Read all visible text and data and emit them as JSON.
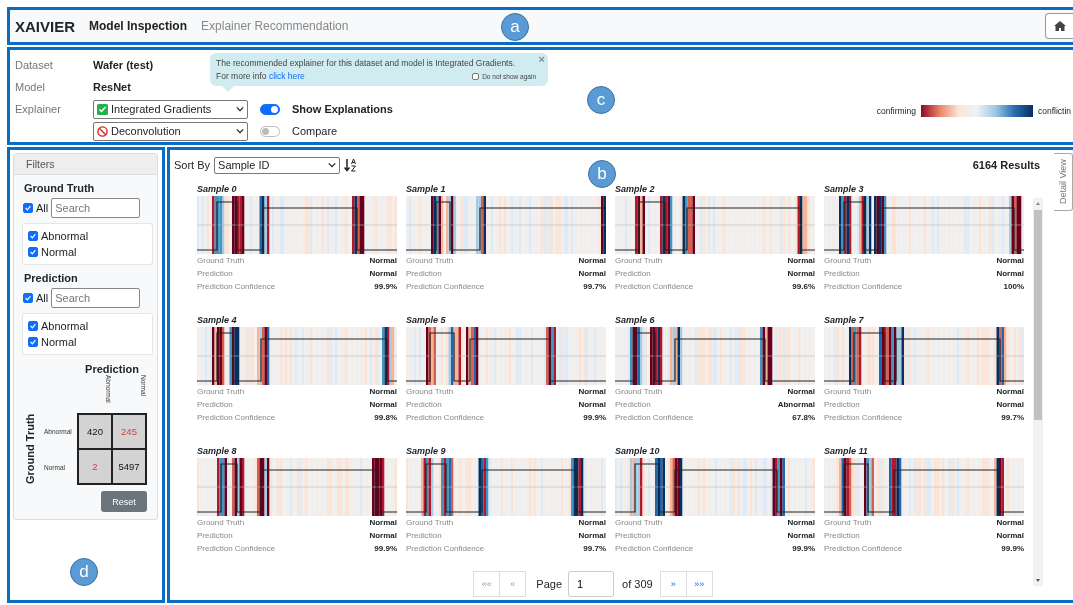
{
  "header": {
    "brand": "XAIVIER",
    "nav": [
      {
        "label": "Model Inspection",
        "selected": true
      },
      {
        "label": "Explainer Recommendation",
        "selected": false
      }
    ],
    "marker": "a"
  },
  "config": {
    "fields": [
      {
        "label": "Dataset",
        "value": "Wafer (test)"
      },
      {
        "label": "Model",
        "value": "ResNet"
      }
    ],
    "explainer_label": "Explainer",
    "explainers": [
      {
        "value": "Integrated Gradients",
        "kind": "recommended"
      },
      {
        "value": "Deconvolution",
        "kind": "rejected"
      }
    ],
    "toggles": [
      {
        "label": "Show Explanations",
        "on": true
      },
      {
        "label": "Compare",
        "on": false
      }
    ],
    "popover": {
      "text": "The recommended explainer for this dataset and model is Integrated Gradients.",
      "more": "For more info",
      "link": "click here",
      "close": "×",
      "dont_show": {
        "label": "Do not show again",
        "checked": false
      }
    },
    "legend": {
      "low": "confirming",
      "high": "conflictin"
    },
    "marker": "c"
  },
  "filters": {
    "title": "Filters",
    "groups": [
      {
        "title": "Ground Truth",
        "all": {
          "label": "All",
          "checked": true
        },
        "search_placeholder": "Search",
        "options": [
          {
            "label": "Abnormal",
            "checked": true
          },
          {
            "label": "Normal",
            "checked": true
          }
        ]
      },
      {
        "title": "Prediction",
        "all": {
          "label": "All",
          "checked": true
        },
        "search_placeholder": "Search",
        "options": [
          {
            "label": "Abnormal",
            "checked": true
          },
          {
            "label": "Normal",
            "checked": true
          }
        ]
      }
    ],
    "matrix": {
      "col_title": "Prediction",
      "row_title": "Ground Truth",
      "cols": [
        "Abnormal",
        "Normal"
      ],
      "rows": [
        {
          "label": "Abnormal",
          "cells": [
            {
              "value": "420",
              "error": false
            },
            {
              "value": "245",
              "error": true
            }
          ]
        },
        {
          "label": "Normal",
          "cells": [
            {
              "value": "2",
              "error": true
            },
            {
              "value": "5497",
              "error": false
            }
          ]
        }
      ]
    },
    "reset": "Reset",
    "marker": "d"
  },
  "results": {
    "sort_label": "Sort By",
    "sort_value": "Sample ID",
    "count": "6164 Results",
    "detail_tab": "Detail View",
    "marker": "b",
    "samples": [
      {
        "title": "Sample 0",
        "fields": [
          {
            "label": "Ground Truth",
            "value": "Normal"
          },
          {
            "label": "Prediction",
            "value": "Normal"
          },
          {
            "label": "Prediction Confidence",
            "value": "99.9%"
          }
        ]
      },
      {
        "title": "Sample 1",
        "fields": [
          {
            "label": "Ground Truth",
            "value": "Normal"
          },
          {
            "label": "Prediction",
            "value": "Normal"
          },
          {
            "label": "Prediction Confidence",
            "value": "99.7%"
          }
        ]
      },
      {
        "title": "Sample 2",
        "fields": [
          {
            "label": "Ground Truth",
            "value": "Normal"
          },
          {
            "label": "Prediction",
            "value": "Normal"
          },
          {
            "label": "Prediction Confidence",
            "value": "99.6%"
          }
        ]
      },
      {
        "title": "Sample 3",
        "fields": [
          {
            "label": "Ground Truth",
            "value": "Normal"
          },
          {
            "label": "Prediction",
            "value": "Normal"
          },
          {
            "label": "Prediction Confidence",
            "value": "100%"
          }
        ]
      },
      {
        "title": "Sample 4",
        "fields": [
          {
            "label": "Ground Truth",
            "value": "Normal"
          },
          {
            "label": "Prediction",
            "value": "Normal"
          },
          {
            "label": "Prediction Confidence",
            "value": "99.8%"
          }
        ]
      },
      {
        "title": "Sample 5",
        "fields": [
          {
            "label": "Ground Truth",
            "value": "Normal"
          },
          {
            "label": "Prediction",
            "value": "Normal"
          },
          {
            "label": "Prediction Confidence",
            "value": "99.9%"
          }
        ]
      },
      {
        "title": "Sample 6",
        "fields": [
          {
            "label": "Ground Truth",
            "value": "Normal"
          },
          {
            "label": "Prediction",
            "value": "Abnormal"
          },
          {
            "label": "Prediction Confidence",
            "value": "67.8%"
          }
        ]
      },
      {
        "title": "Sample 7",
        "fields": [
          {
            "label": "Ground Truth",
            "value": "Normal"
          },
          {
            "label": "Prediction",
            "value": "Normal"
          },
          {
            "label": "Prediction Confidence",
            "value": "99.7%"
          }
        ]
      },
      {
        "title": "Sample 8",
        "fields": [
          {
            "label": "Ground Truth",
            "value": "Normal"
          },
          {
            "label": "Prediction",
            "value": "Normal"
          },
          {
            "label": "Prediction Confidence",
            "value": "99.9%"
          }
        ]
      },
      {
        "title": "Sample 9",
        "fields": [
          {
            "label": "Ground Truth",
            "value": "Normal"
          },
          {
            "label": "Prediction",
            "value": "Normal"
          },
          {
            "label": "Prediction Confidence",
            "value": "99.7%"
          }
        ]
      },
      {
        "title": "Sample 10",
        "fields": [
          {
            "label": "Ground Truth",
            "value": "Normal"
          },
          {
            "label": "Prediction",
            "value": "Normal"
          },
          {
            "label": "Prediction Confidence",
            "value": "99.9%"
          }
        ]
      },
      {
        "title": "Sample 11",
        "fields": [
          {
            "label": "Ground Truth",
            "value": "Normal"
          },
          {
            "label": "Prediction",
            "value": "Normal"
          },
          {
            "label": "Prediction Confidence",
            "value": "99.9%"
          }
        ]
      }
    ],
    "pagination": {
      "buttons": [
        {
          "label": "««",
          "disabled": true
        },
        {
          "label": "«",
          "disabled": true
        }
      ],
      "page_label": "Page",
      "page": "1",
      "of": "of 309",
      "next_buttons": [
        {
          "label": "»",
          "disabled": false
        },
        {
          "label": "»»",
          "disabled": false
        }
      ]
    }
  }
}
